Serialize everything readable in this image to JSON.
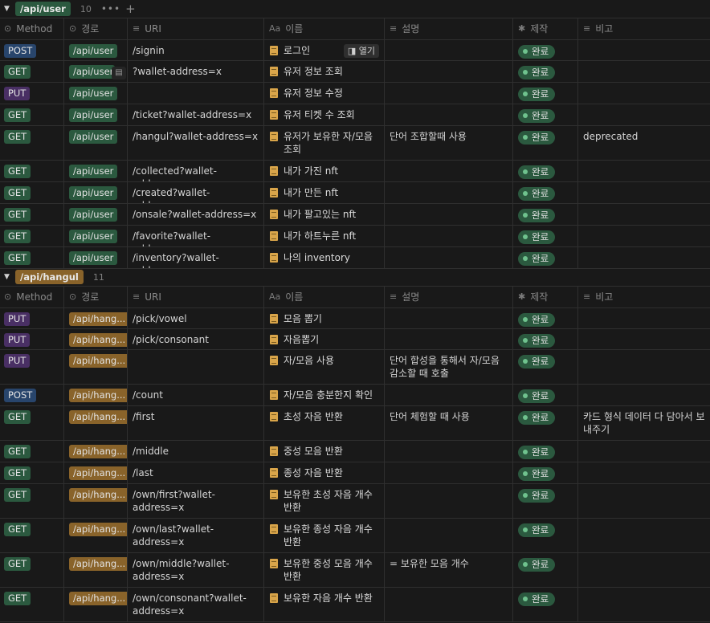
{
  "columns": {
    "method": "Method",
    "path": "경로",
    "uri": "URI",
    "name": "이름",
    "name_prefix": "Aa",
    "desc": "설명",
    "status": "제작",
    "note": "비고"
  },
  "open_label": "열기",
  "groups": [
    {
      "tag": "/api/user",
      "count": "10",
      "rows": [
        {
          "method": "POST",
          "path": "/api/user",
          "uri": "/signin",
          "name": "로그인",
          "desc": "",
          "status": "완료",
          "note": ""
        },
        {
          "method": "GET",
          "path": "/api/user",
          "uri": "?wallet-address=x",
          "name": "유저 정보 조회",
          "desc": "",
          "status": "완료",
          "note": ""
        },
        {
          "method": "PUT",
          "path": "/api/user",
          "uri": "",
          "name": "유저 정보 수정",
          "desc": "",
          "status": "완료",
          "note": ""
        },
        {
          "method": "GET",
          "path": "/api/user",
          "uri": "/ticket?wallet-address=x",
          "name": "유저 티켓 수 조회",
          "desc": "",
          "status": "완료",
          "note": ""
        },
        {
          "method": "GET",
          "path": "/api/user",
          "uri": "/hangul?wallet-address=x",
          "name": "유저가 보유한 자/모음 조회",
          "desc": "단어 조합할때 사용",
          "status": "완료",
          "note": "deprecated"
        },
        {
          "method": "GET",
          "path": "/api/user",
          "uri": "/collected?wallet-address=x",
          "name": "내가 가진 nft",
          "desc": "",
          "status": "완료",
          "note": ""
        },
        {
          "method": "GET",
          "path": "/api/user",
          "uri": "/created?wallet-address=x",
          "name": "내가 만든 nft",
          "desc": "",
          "status": "완료",
          "note": ""
        },
        {
          "method": "GET",
          "path": "/api/user",
          "uri": "/onsale?wallet-address=x",
          "name": "내가 팔고있는 nft",
          "desc": "",
          "status": "완료",
          "note": ""
        },
        {
          "method": "GET",
          "path": "/api/user",
          "uri": "/favorite?wallet-address=x",
          "name": "내가 하트누른 nft",
          "desc": "",
          "status": "완료",
          "note": ""
        },
        {
          "method": "GET",
          "path": "/api/user",
          "uri": "/inventory?wallet-address=x",
          "name": "나의 inventory",
          "desc": "",
          "status": "완료",
          "note": ""
        }
      ]
    },
    {
      "tag": "/api/hangul",
      "count": "11",
      "rows": [
        {
          "method": "PUT",
          "path": "/api/hang...",
          "uri": "/pick/vowel",
          "name": "모음 뽑기",
          "desc": "",
          "status": "완료",
          "note": ""
        },
        {
          "method": "PUT",
          "path": "/api/hang...",
          "uri": "/pick/consonant",
          "name": "자음뽑기",
          "desc": "",
          "status": "완료",
          "note": ""
        },
        {
          "method": "PUT",
          "path": "/api/hang...",
          "uri": "",
          "name": "자/모음 사용",
          "desc": "단어 합성을 통해서 자/모음 감소할 때 호출",
          "status": "완료",
          "note": ""
        },
        {
          "method": "POST",
          "path": "/api/hang...",
          "uri": "/count",
          "name": "자/모음 충분한지 확인",
          "desc": "",
          "status": "완료",
          "note": ""
        },
        {
          "method": "GET",
          "path": "/api/hang...",
          "uri": "/first",
          "name": "초성 자음 반환",
          "desc": "단어 체험할 때 사용",
          "status": "완료",
          "note": "카드 형식 데이터 다 담아서 보내주기"
        },
        {
          "method": "GET",
          "path": "/api/hang...",
          "uri": "/middle",
          "name": "중성 모음 반환",
          "desc": "",
          "status": "완료",
          "note": ""
        },
        {
          "method": "GET",
          "path": "/api/hang...",
          "uri": "/last",
          "name": "종성 자음 반환",
          "desc": "",
          "status": "완료",
          "note": ""
        },
        {
          "method": "GET",
          "path": "/api/hang...",
          "uri": "/own/first?wallet-address=x",
          "name": "보유한 초성 자음 개수 반환",
          "desc": "",
          "status": "완료",
          "note": ""
        },
        {
          "method": "GET",
          "path": "/api/hang...",
          "uri": "/own/last?wallet-address=x",
          "name": "보유한 종성 자음 개수 반환",
          "desc": "",
          "status": "완료",
          "note": ""
        },
        {
          "method": "GET",
          "path": "/api/hang...",
          "uri": "/own/middle?wallet-address=x",
          "name": "보유한 중성 모음 개수 반환",
          "desc": "= 보유한 모음 개수",
          "status": "완료",
          "note": ""
        },
        {
          "method": "GET",
          "path": "/api/hang...",
          "uri": "/own/consonant?wallet-address=x",
          "name": "보유한 자음 개수 반환",
          "desc": "",
          "status": "완료",
          "note": ""
        }
      ]
    }
  ]
}
